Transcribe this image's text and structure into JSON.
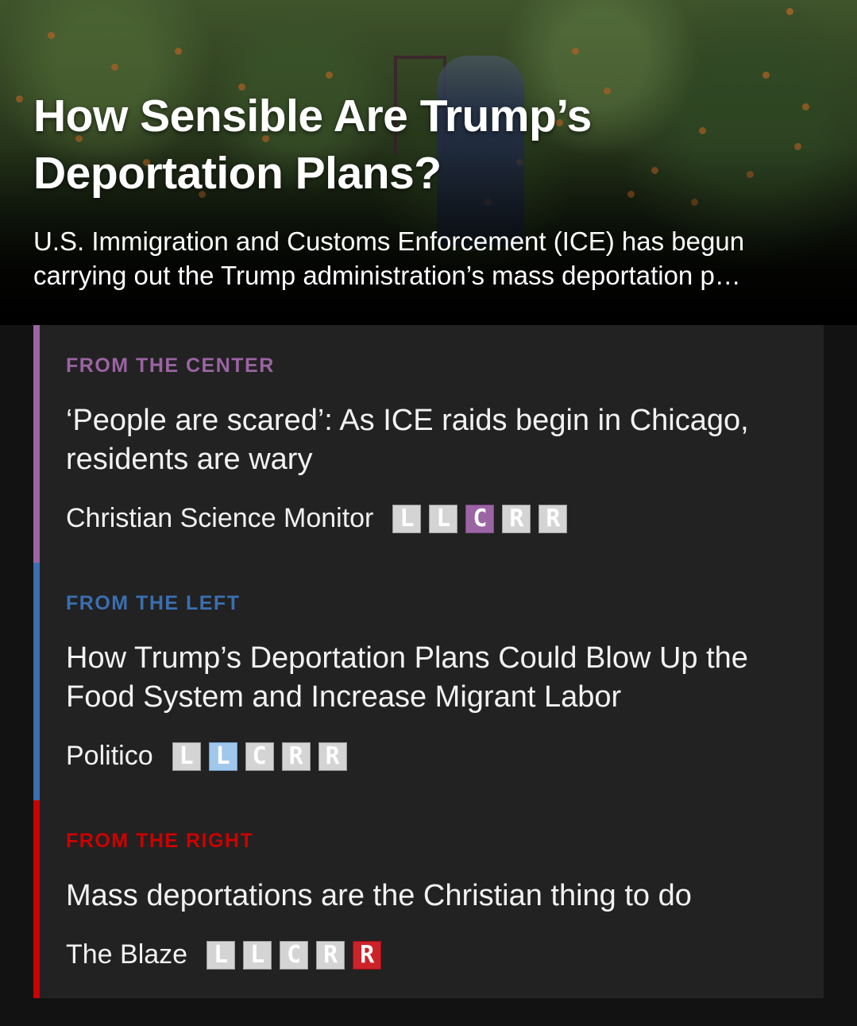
{
  "hero": {
    "image_alt": "Farmworker picking oranges in an orchard",
    "title": "How Sensible Are Trump’s Deportation Plans?",
    "description": "U.S. Immigration and Customs Enforcement (ICE) has begun carrying out the Trump administration’s mass deportation p…"
  },
  "colors": {
    "center": "#9b64a3",
    "left": "#3a6fb0",
    "right": "#cc0000",
    "left_bias_active": "#a0c8ec",
    "inactive_bias": "#d4d4d4"
  },
  "sections": [
    {
      "label": "FROM THE CENTER",
      "headline": "‘People are scared’: As ICE raids begin in Chicago, residents are wary",
      "source": "Christian Science Monitor",
      "bias_letters": [
        "L",
        "L",
        "C",
        "R",
        "R"
      ],
      "bias_active_index": 2,
      "bias_rating": "Center"
    },
    {
      "label": "FROM THE LEFT",
      "headline": "How Trump’s Deportation Plans Could Blow Up the Food System and Increase Migrant Labor",
      "source": "Politico",
      "bias_letters": [
        "L",
        "L",
        "C",
        "R",
        "R"
      ],
      "bias_active_index": 1,
      "bias_rating": "Lean Left"
    },
    {
      "label": "FROM THE RIGHT",
      "headline": "Mass deportations are the Christian thing to do",
      "source": "The Blaze",
      "bias_letters": [
        "L",
        "L",
        "C",
        "R",
        "R"
      ],
      "bias_active_index": 4,
      "bias_rating": "Right"
    }
  ]
}
